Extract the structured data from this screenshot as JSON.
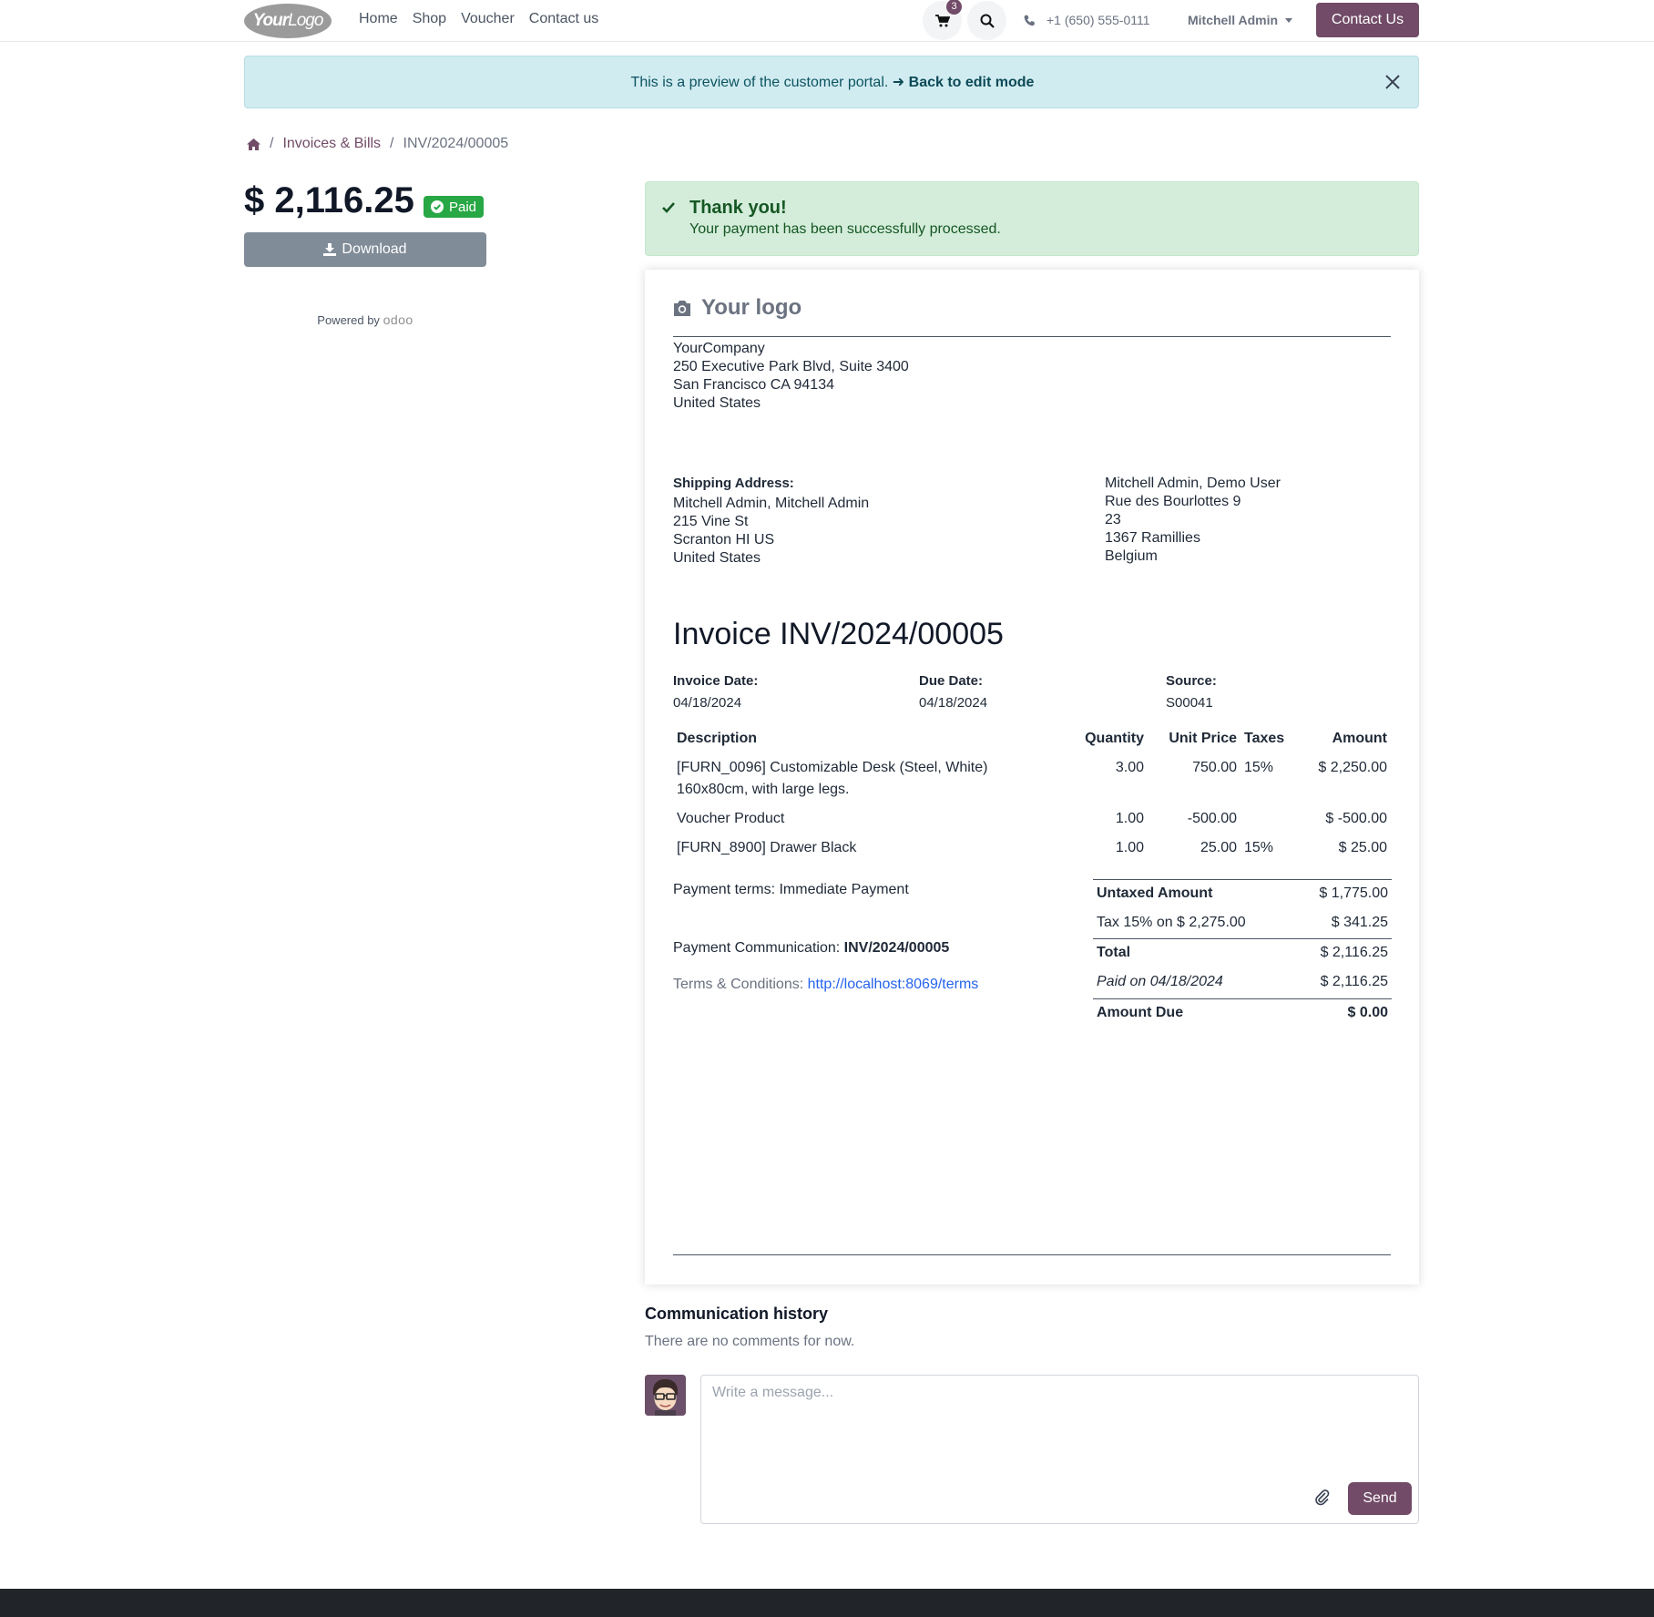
{
  "nav": {
    "logo_bold": "Your",
    "logo_light": "Logo",
    "links": [
      "Home",
      "Shop",
      "Voucher",
      "Contact us"
    ],
    "cart_count": "3",
    "phone": "+1 (650) 555-0111",
    "user": "Mitchell Admin",
    "contact_button": "Contact Us"
  },
  "preview": {
    "text": "This is a preview of the customer portal.",
    "link": "Back to edit mode"
  },
  "breadcrumb": {
    "section": "Invoices & Bills",
    "current": "INV/2024/00005"
  },
  "sidebar": {
    "amount": "$ 2,116.25",
    "status": "Paid",
    "download": "Download",
    "powered_by": "Powered by",
    "powered_brand": "odoo"
  },
  "success": {
    "title": "Thank you!",
    "message": "Your payment has been successfully processed."
  },
  "invoice": {
    "logo_text": "Your logo",
    "company": {
      "name": "YourCompany",
      "street": "250 Executive Park Blvd, Suite 3400",
      "city": "San Francisco CA 94134",
      "country": "United States"
    },
    "shipping": {
      "label": "Shipping Address:",
      "name": "Mitchell Admin, Mitchell Admin",
      "street": "215 Vine St",
      "city": "Scranton HI US",
      "country": "United States"
    },
    "billing": {
      "name": "Mitchell Admin, Demo User",
      "street": "Rue des Bourlottes 9",
      "street2": "23",
      "city": "1367 Ramillies",
      "country": "Belgium"
    },
    "title": "Invoice INV/2024/00005",
    "invoice_date_label": "Invoice Date:",
    "invoice_date": "04/18/2024",
    "due_date_label": "Due Date:",
    "due_date": "04/18/2024",
    "source_label": "Source:",
    "source": "S00041",
    "columns": {
      "description": "Description",
      "quantity": "Quantity",
      "unit_price": "Unit Price",
      "taxes": "Taxes",
      "amount": "Amount"
    },
    "lines": [
      {
        "desc1": "[FURN_0096] Customizable Desk (Steel, White)",
        "desc2": "160x80cm, with large legs.",
        "qty": "3.00",
        "price": "750.00",
        "tax": "15%",
        "amount": "$ 2,250.00"
      },
      {
        "desc1": "Voucher Product",
        "desc2": "",
        "qty": "1.00",
        "price": "-500.00",
        "tax": "",
        "amount": "$ -500.00"
      },
      {
        "desc1": "[FURN_8900] Drawer Black",
        "desc2": "",
        "qty": "1.00",
        "price": "25.00",
        "tax": "15%",
        "amount": "$ 25.00"
      }
    ],
    "payment_terms": "Payment terms: Immediate Payment",
    "payment_comm_label": "Payment Communication:",
    "payment_comm": "INV/2024/00005",
    "terms_label": "Terms & Conditions:",
    "terms_link": "http://localhost:8069/terms",
    "totals": {
      "untaxed_label": "Untaxed Amount",
      "untaxed": "$ 1,775.00",
      "tax_label": "Tax 15% on $ 2,275.00",
      "tax": "$ 341.25",
      "total_label": "Total",
      "total": "$ 2,116.25",
      "paid_label": "Paid on 04/18/2024",
      "paid": "$ 2,116.25",
      "due_label": "Amount Due",
      "due": "$ 0.00"
    }
  },
  "communication": {
    "title": "Communication history",
    "empty": "There are no comments for now.",
    "placeholder": "Write a message...",
    "send": "Send"
  },
  "colors": {
    "brand": "#714b67",
    "success": "#28a745",
    "info_bg": "#d1ecf1"
  }
}
